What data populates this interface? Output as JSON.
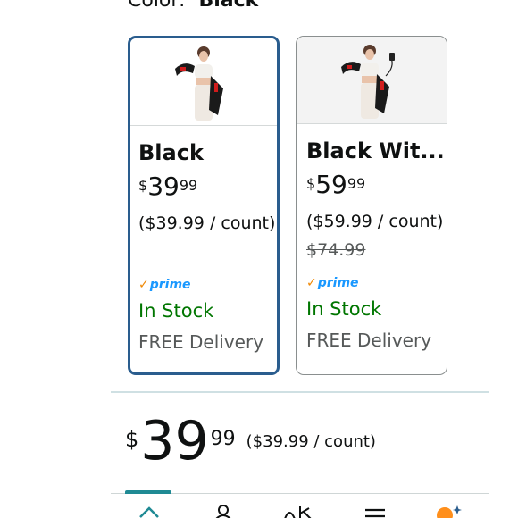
{
  "color_selector": {
    "label": "Color:",
    "selected_value": "Black"
  },
  "options": [
    {
      "name": "Black",
      "price": {
        "currency": "$",
        "whole": "39",
        "fraction": "99"
      },
      "unit_price": "($39.99 / count)",
      "list_price": "",
      "prime_label": "prime",
      "availability": "In Stock",
      "delivery": "FREE Delivery",
      "selected": true
    },
    {
      "name": "Black Wit...",
      "price": {
        "currency": "$",
        "whole": "59",
        "fraction": "99"
      },
      "unit_price": "($59.99 / count)",
      "list_price": "$74.99",
      "prime_label": "prime",
      "availability": "In Stock",
      "delivery": "FREE Delivery",
      "selected": false
    }
  ],
  "summary_price": {
    "currency": "$",
    "whole": "39",
    "fraction": "99",
    "unit_price": "($39.99 / count)"
  },
  "colors": {
    "selected_border": "#2a5d8e",
    "in_stock": "#007600",
    "prime_blue": "#1a98ff",
    "prime_check": "#f08804",
    "nav_indicator": "#1f8a94",
    "cart_orange": "#ff8f1c"
  },
  "bottom_nav": [
    "home-icon",
    "profile-icon",
    "ai-sparkle-icon",
    "menu-icon",
    "cart-icon"
  ]
}
